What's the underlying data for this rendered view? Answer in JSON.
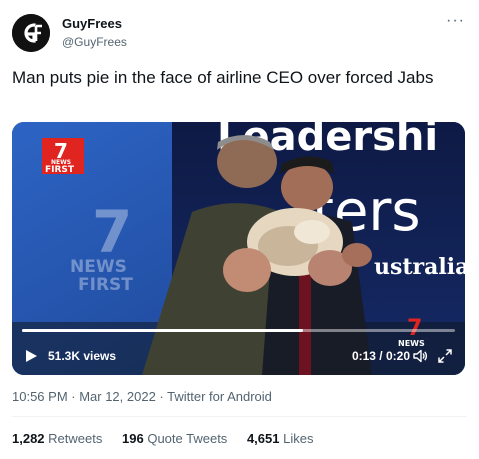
{
  "author": {
    "display_name": "GuyFrees",
    "handle": "@GuyFrees",
    "avatar_initials": "G",
    "more_icon": "ellipsis-icon"
  },
  "tweet": {
    "text": "Man puts pie in the face of airline CEO over forced Jabs"
  },
  "video": {
    "views": "51.3K views",
    "time": "0:13 / 0:20",
    "progress_fraction": 0.65,
    "backdrop_text_1": "Leadershi",
    "backdrop_text_2": "ters",
    "backdrop_text_3": "ustralia",
    "logo_top": "NEWS",
    "logo_bottom": "FIRST",
    "logo_number": "7",
    "watermark_news": "NEWS",
    "watermark_first": "FIRST",
    "bug_news": "NEWS",
    "play_icon": "play-icon",
    "volume_icon": "volume-icon",
    "fullscreen_icon": "fullscreen-icon"
  },
  "meta": {
    "timestamp": "10:56 PM · Mar 12, 2022 · Twitter for Android"
  },
  "stats": {
    "retweets_count": "1,282",
    "retweets_label": "Retweets",
    "quotes_count": "196",
    "quotes_label": "Quote Tweets",
    "likes_count": "4,651",
    "likes_label": "Likes"
  },
  "colors": {
    "text_primary": "#0f1419",
    "text_secondary": "#536471",
    "divider": "#eff3f4",
    "news_red": "#e0241f"
  }
}
